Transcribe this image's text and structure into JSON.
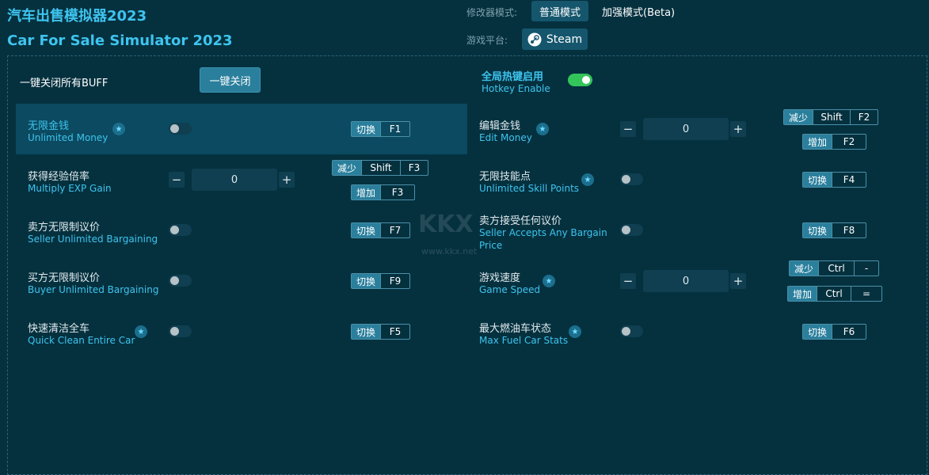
{
  "header": {
    "title_cn": "汽车出售模拟器2023",
    "title_en": "Car For Sale Simulator 2023",
    "mode_label": "修改器模式:",
    "mode_normal": "普通模式",
    "mode_enhanced": "加强模式(Beta)",
    "platform_label": "游戏平台:",
    "platform": "Steam"
  },
  "controls": {
    "close_all_label": "一键关闭所有BUFF",
    "close_all_button": "一键关闭",
    "hotkey_cn": "全局热键启用",
    "hotkey_en": "Hotkey Enable",
    "hotkey_enabled": true
  },
  "features": {
    "unlimited_money": {
      "cn": "无限金钱",
      "en": "Unlimited Money",
      "tag": "切换",
      "key": "F1"
    },
    "edit_money": {
      "cn": "编辑金钱",
      "en": "Edit Money",
      "value": "0",
      "dec_tag": "减少",
      "dec_mod": "Shift",
      "dec_key": "F2",
      "inc_tag": "增加",
      "inc_key": "F2"
    },
    "multiply_exp": {
      "cn": "获得经验倍率",
      "en": "Multiply EXP Gain",
      "value": "0",
      "dec_tag": "减少",
      "dec_mod": "Shift",
      "dec_key": "F3",
      "inc_tag": "增加",
      "inc_key": "F3"
    },
    "unlimited_skill": {
      "cn": "无限技能点",
      "en": "Unlimited Skill Points",
      "tag": "切换",
      "key": "F4"
    },
    "seller_bargain": {
      "cn": "卖方无限制议价",
      "en": "Seller Unlimited Bargaining",
      "tag": "切换",
      "key": "F7"
    },
    "seller_accepts": {
      "cn": "卖方接受任何议价",
      "en": "Seller Accepts Any Bargain",
      "en2": "Price",
      "tag": "切换",
      "key": "F8"
    },
    "buyer_bargain": {
      "cn": "买方无限制议价",
      "en": "Buyer Unlimited Bargaining",
      "tag": "切换",
      "key": "F9"
    },
    "game_speed": {
      "cn": "游戏速度",
      "en": "Game Speed",
      "value": "0",
      "dec_tag": "减少",
      "dec_mod": "Ctrl",
      "dec_key": "-",
      "inc_tag": "增加",
      "inc_mod": "Ctrl",
      "inc_key": "="
    },
    "quick_clean": {
      "cn": "快速清洁全车",
      "en": "Quick Clean Entire Car",
      "tag": "切换",
      "key": "F5"
    },
    "max_fuel": {
      "cn": "最大燃油车状态",
      "en": "Max Fuel Car Stats",
      "tag": "切换",
      "key": "F6"
    }
  },
  "watermark": {
    "logo": "KKX",
    "url": "www.kkx.net"
  },
  "colors": {
    "background": "#05313f",
    "accent": "#3ec4ee",
    "toggle_on": "#34c55a"
  }
}
